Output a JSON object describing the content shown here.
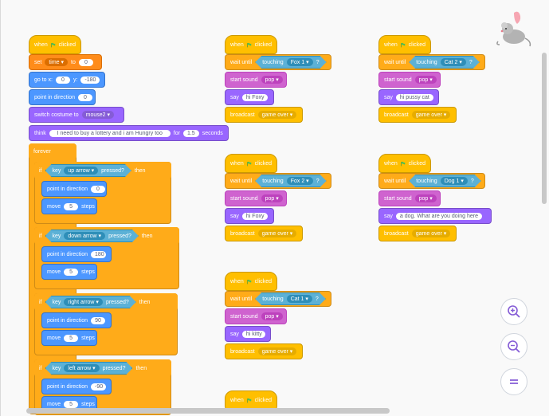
{
  "columns": {
    "col1": {
      "hat_when": "when",
      "hat_clicked": "clicked",
      "set_label": "set",
      "set_var": "time",
      "set_to": "to",
      "set_value": "0",
      "goto_label": "go to x:",
      "goto_x": "0",
      "goto_y_label": "y:",
      "goto_y": "-180",
      "point_label": "point in direction",
      "point_value": "0",
      "switch_label": "switch costume to",
      "switch_value": "mouse2",
      "think_label": "think",
      "think_text": "I need to buy a lottery and i am Hungry too",
      "think_for": "for",
      "think_secs": "1.5",
      "think_seconds": "seconds",
      "forever_label": "forever",
      "ifs": [
        {
          "if": "if",
          "key": "key",
          "key_value": "up arrow",
          "pressed": "pressed?",
          "then": "then",
          "dir_label": "point in direction",
          "dir_value": "0",
          "move": "move",
          "steps_value": "5",
          "steps": "steps"
        },
        {
          "if": "if",
          "key": "key",
          "key_value": "down arrow",
          "pressed": "pressed?",
          "then": "then",
          "dir_label": "point in direction",
          "dir_value": "180",
          "move": "move",
          "steps_value": "5",
          "steps": "steps"
        },
        {
          "if": "if",
          "key": "key",
          "key_value": "right arrow",
          "pressed": "pressed?",
          "then": "then",
          "dir_label": "point in direction",
          "dir_value": "90",
          "move": "move",
          "steps_value": "5",
          "steps": "steps"
        },
        {
          "if": "if",
          "key": "key",
          "key_value": "left arrow",
          "pressed": "pressed?",
          "then": "then",
          "dir_label": "point in direction",
          "dir_value": "-90",
          "move": "move",
          "steps_value": "5",
          "steps": "steps"
        }
      ]
    },
    "scripts": [
      {
        "when": "when",
        "clicked": "clicked",
        "wait": "wait until",
        "touching": "touching",
        "target": "Fox 1",
        "q": "?",
        "sound": "start sound",
        "sound_value": "pop",
        "say": "say",
        "say_text": "hi Foxy",
        "broadcast": "broadcast",
        "broadcast_value": "game over"
      },
      {
        "when": "when",
        "clicked": "clicked",
        "wait": "wait until",
        "touching": "touching",
        "target": "Fox 2",
        "q": "?",
        "sound": "start sound",
        "sound_value": "pop",
        "say": "say",
        "say_text": "hi Foxy",
        "broadcast": "broadcast",
        "broadcast_value": "game over"
      },
      {
        "when": "when",
        "clicked": "clicked",
        "wait": "wait until",
        "touching": "touching",
        "target": "Cat 1",
        "q": "?",
        "sound": "start sound",
        "sound_value": "pop",
        "say": "say",
        "say_text": "hi kitty",
        "broadcast": "broadcast",
        "broadcast_value": "game over"
      },
      {
        "when": "when",
        "clicked": "clicked"
      },
      {
        "when": "when",
        "clicked": "clicked",
        "wait": "wait until",
        "touching": "touching",
        "target": "Cat 2",
        "q": "?",
        "sound": "start sound",
        "sound_value": "pop",
        "say": "say",
        "say_text": "hi pussy cat",
        "broadcast": "broadcast",
        "broadcast_value": "game over"
      },
      {
        "when": "when",
        "clicked": "clicked",
        "wait": "wait until",
        "touching": "touching",
        "target": "Dog 1",
        "q": "?",
        "sound": "start sound",
        "sound_value": "pop",
        "say": "say",
        "say_text": "a dog. What are you doing here",
        "broadcast": "broadcast",
        "broadcast_value": "game over"
      }
    ]
  },
  "zoom": {
    "in_icon": "zoom-in-icon",
    "out_icon": "zoom-out-icon",
    "reset_icon": "zoom-reset-icon"
  },
  "colors": {
    "events": "#ffbf00",
    "motion": "#4c97ff",
    "looks": "#9966ff",
    "sound": "#cf63cf",
    "control": "#ffab19",
    "sensing": "#5cb1d6",
    "variables": "#ff8c1a"
  }
}
